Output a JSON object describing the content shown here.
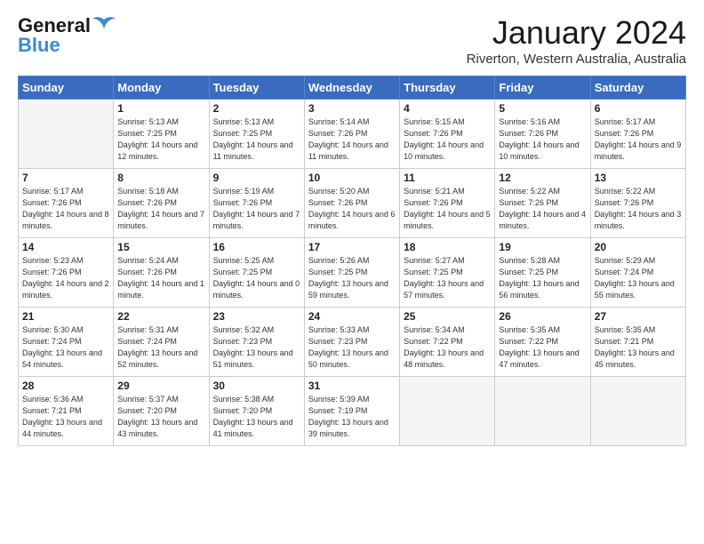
{
  "header": {
    "logo_line1": "General",
    "logo_line2": "Blue",
    "month_title": "January 2024",
    "subtitle": "Riverton, Western Australia, Australia"
  },
  "days_of_week": [
    "Sunday",
    "Monday",
    "Tuesday",
    "Wednesday",
    "Thursday",
    "Friday",
    "Saturday"
  ],
  "weeks": [
    [
      {
        "day": "",
        "empty": true
      },
      {
        "day": "1",
        "sunrise": "Sunrise: 5:13 AM",
        "sunset": "Sunset: 7:25 PM",
        "daylight": "Daylight: 14 hours and 12 minutes."
      },
      {
        "day": "2",
        "sunrise": "Sunrise: 5:13 AM",
        "sunset": "Sunset: 7:25 PM",
        "daylight": "Daylight: 14 hours and 11 minutes."
      },
      {
        "day": "3",
        "sunrise": "Sunrise: 5:14 AM",
        "sunset": "Sunset: 7:26 PM",
        "daylight": "Daylight: 14 hours and 11 minutes."
      },
      {
        "day": "4",
        "sunrise": "Sunrise: 5:15 AM",
        "sunset": "Sunset: 7:26 PM",
        "daylight": "Daylight: 14 hours and 10 minutes."
      },
      {
        "day": "5",
        "sunrise": "Sunrise: 5:16 AM",
        "sunset": "Sunset: 7:26 PM",
        "daylight": "Daylight: 14 hours and 10 minutes."
      },
      {
        "day": "6",
        "sunrise": "Sunrise: 5:17 AM",
        "sunset": "Sunset: 7:26 PM",
        "daylight": "Daylight: 14 hours and 9 minutes."
      }
    ],
    [
      {
        "day": "7",
        "sunrise": "Sunrise: 5:17 AM",
        "sunset": "Sunset: 7:26 PM",
        "daylight": "Daylight: 14 hours and 8 minutes."
      },
      {
        "day": "8",
        "sunrise": "Sunrise: 5:18 AM",
        "sunset": "Sunset: 7:26 PM",
        "daylight": "Daylight: 14 hours and 7 minutes."
      },
      {
        "day": "9",
        "sunrise": "Sunrise: 5:19 AM",
        "sunset": "Sunset: 7:26 PM",
        "daylight": "Daylight: 14 hours and 7 minutes."
      },
      {
        "day": "10",
        "sunrise": "Sunrise: 5:20 AM",
        "sunset": "Sunset: 7:26 PM",
        "daylight": "Daylight: 14 hours and 6 minutes."
      },
      {
        "day": "11",
        "sunrise": "Sunrise: 5:21 AM",
        "sunset": "Sunset: 7:26 PM",
        "daylight": "Daylight: 14 hours and 5 minutes."
      },
      {
        "day": "12",
        "sunrise": "Sunrise: 5:22 AM",
        "sunset": "Sunset: 7:26 PM",
        "daylight": "Daylight: 14 hours and 4 minutes."
      },
      {
        "day": "13",
        "sunrise": "Sunrise: 5:22 AM",
        "sunset": "Sunset: 7:26 PM",
        "daylight": "Daylight: 14 hours and 3 minutes."
      }
    ],
    [
      {
        "day": "14",
        "sunrise": "Sunrise: 5:23 AM",
        "sunset": "Sunset: 7:26 PM",
        "daylight": "Daylight: 14 hours and 2 minutes."
      },
      {
        "day": "15",
        "sunrise": "Sunrise: 5:24 AM",
        "sunset": "Sunset: 7:26 PM",
        "daylight": "Daylight: 14 hours and 1 minute."
      },
      {
        "day": "16",
        "sunrise": "Sunrise: 5:25 AM",
        "sunset": "Sunset: 7:25 PM",
        "daylight": "Daylight: 14 hours and 0 minutes."
      },
      {
        "day": "17",
        "sunrise": "Sunrise: 5:26 AM",
        "sunset": "Sunset: 7:25 PM",
        "daylight": "Daylight: 13 hours and 59 minutes."
      },
      {
        "day": "18",
        "sunrise": "Sunrise: 5:27 AM",
        "sunset": "Sunset: 7:25 PM",
        "daylight": "Daylight: 13 hours and 57 minutes."
      },
      {
        "day": "19",
        "sunrise": "Sunrise: 5:28 AM",
        "sunset": "Sunset: 7:25 PM",
        "daylight": "Daylight: 13 hours and 56 minutes."
      },
      {
        "day": "20",
        "sunrise": "Sunrise: 5:29 AM",
        "sunset": "Sunset: 7:24 PM",
        "daylight": "Daylight: 13 hours and 55 minutes."
      }
    ],
    [
      {
        "day": "21",
        "sunrise": "Sunrise: 5:30 AM",
        "sunset": "Sunset: 7:24 PM",
        "daylight": "Daylight: 13 hours and 54 minutes."
      },
      {
        "day": "22",
        "sunrise": "Sunrise: 5:31 AM",
        "sunset": "Sunset: 7:24 PM",
        "daylight": "Daylight: 13 hours and 52 minutes."
      },
      {
        "day": "23",
        "sunrise": "Sunrise: 5:32 AM",
        "sunset": "Sunset: 7:23 PM",
        "daylight": "Daylight: 13 hours and 51 minutes."
      },
      {
        "day": "24",
        "sunrise": "Sunrise: 5:33 AM",
        "sunset": "Sunset: 7:23 PM",
        "daylight": "Daylight: 13 hours and 50 minutes."
      },
      {
        "day": "25",
        "sunrise": "Sunrise: 5:34 AM",
        "sunset": "Sunset: 7:22 PM",
        "daylight": "Daylight: 13 hours and 48 minutes."
      },
      {
        "day": "26",
        "sunrise": "Sunrise: 5:35 AM",
        "sunset": "Sunset: 7:22 PM",
        "daylight": "Daylight: 13 hours and 47 minutes."
      },
      {
        "day": "27",
        "sunrise": "Sunrise: 5:35 AM",
        "sunset": "Sunset: 7:21 PM",
        "daylight": "Daylight: 13 hours and 45 minutes."
      }
    ],
    [
      {
        "day": "28",
        "sunrise": "Sunrise: 5:36 AM",
        "sunset": "Sunset: 7:21 PM",
        "daylight": "Daylight: 13 hours and 44 minutes."
      },
      {
        "day": "29",
        "sunrise": "Sunrise: 5:37 AM",
        "sunset": "Sunset: 7:20 PM",
        "daylight": "Daylight: 13 hours and 43 minutes."
      },
      {
        "day": "30",
        "sunrise": "Sunrise: 5:38 AM",
        "sunset": "Sunset: 7:20 PM",
        "daylight": "Daylight: 13 hours and 41 minutes."
      },
      {
        "day": "31",
        "sunrise": "Sunrise: 5:39 AM",
        "sunset": "Sunset: 7:19 PM",
        "daylight": "Daylight: 13 hours and 39 minutes."
      },
      {
        "day": "",
        "empty": true
      },
      {
        "day": "",
        "empty": true
      },
      {
        "day": "",
        "empty": true
      }
    ]
  ]
}
